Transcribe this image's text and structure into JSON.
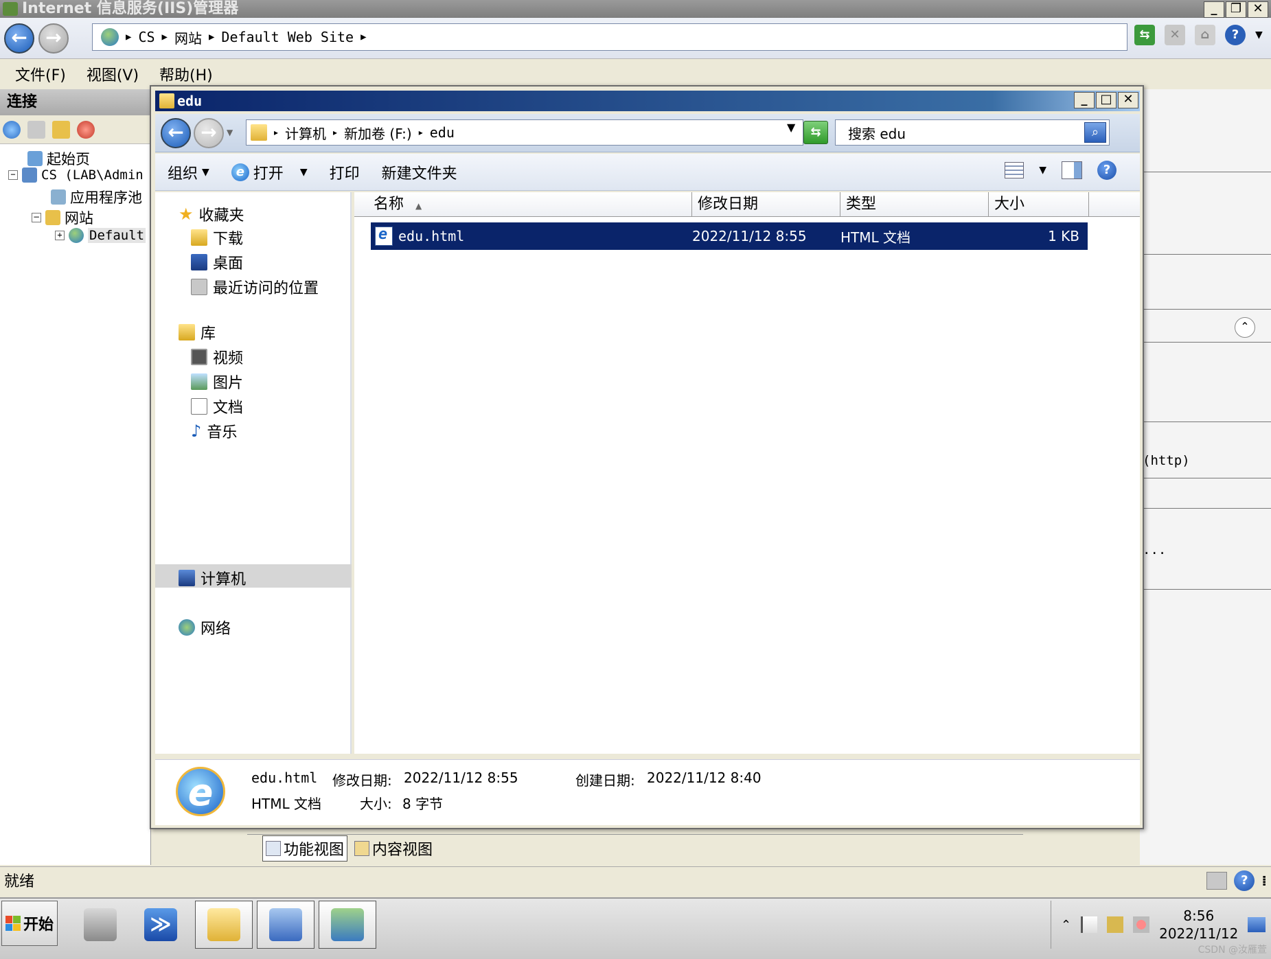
{
  "iis": {
    "title": "Internet 信息服务(IIS)管理器",
    "breadcrumb": [
      "CS",
      "网站",
      "Default Web Site"
    ],
    "menu": [
      "文件(F)",
      "视图(V)",
      "帮助(H)"
    ],
    "connections_title": "连接",
    "tree": {
      "start_page": "起始页",
      "server": "CS (LAB\\Admin",
      "app_pools": "应用程序池",
      "sites": "网站",
      "default_site": "Default"
    },
    "right_fragments": [
      "(http)",
      "..."
    ],
    "view_tabs": {
      "features": "功能视图",
      "content": "内容视图"
    },
    "status": "就绪"
  },
  "explorer": {
    "title": "edu",
    "path": [
      "计算机",
      "新加卷 (F:)",
      "edu"
    ],
    "search_placeholder": "搜索 edu",
    "toolbar": {
      "organize": "组织",
      "open": "打开",
      "print": "打印",
      "new_folder": "新建文件夹"
    },
    "nav": {
      "favorites": "收藏夹",
      "downloads": "下载",
      "desktop": "桌面",
      "recent": "最近访问的位置",
      "libraries": "库",
      "videos": "视频",
      "pictures": "图片",
      "documents": "文档",
      "music": "音乐",
      "computer": "计算机",
      "network": "网络"
    },
    "columns": {
      "name": "名称",
      "date": "修改日期",
      "type": "类型",
      "size": "大小"
    },
    "files": [
      {
        "name": "edu.html",
        "date": "2022/11/12 8:55",
        "type": "HTML 文档",
        "size": "1 KB"
      }
    ],
    "details": {
      "name": "edu.html",
      "modified_label": "修改日期:",
      "modified": "2022/11/12 8:55",
      "created_label": "创建日期:",
      "created": "2022/11/12 8:40",
      "type": "HTML 文档",
      "size_label": "大小:",
      "size": "8 字节"
    }
  },
  "taskbar": {
    "start": "开始",
    "time": "8:56",
    "date": "2022/11/12"
  },
  "watermark": "CSDN @汝雁萱",
  "colors": {
    "selection": "#0a246a",
    "title_active": "#0a246a"
  }
}
